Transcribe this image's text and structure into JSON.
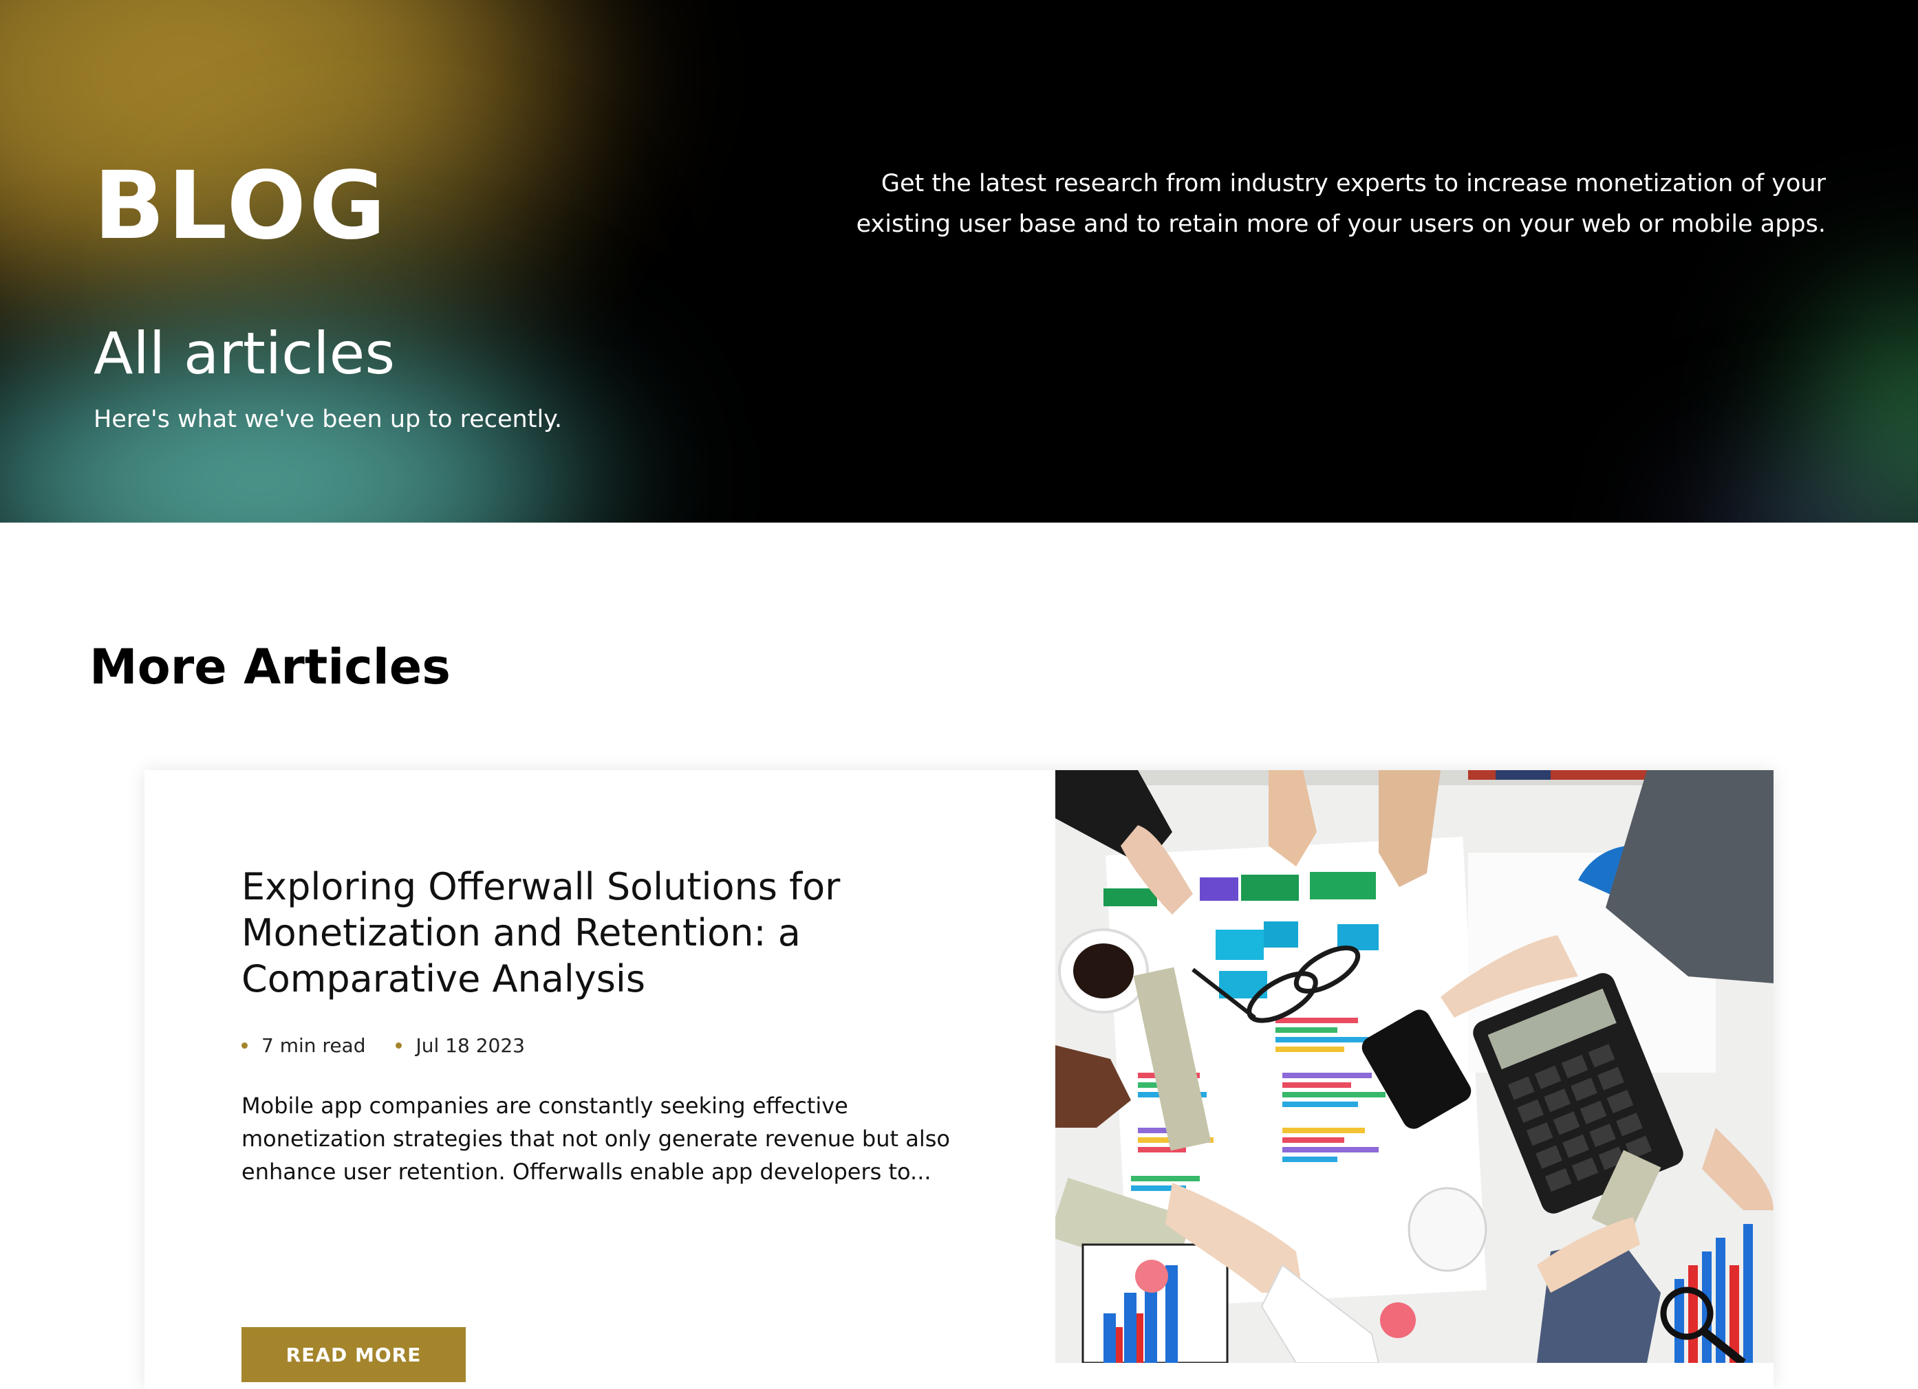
{
  "hero": {
    "title": "BLOG",
    "description": "Get the latest research from industry experts to increase monetization of your existing user base and to retain more of your users on your web or mobile apps.",
    "subtitle": "All articles",
    "tagline": "Here's what we've been up to recently."
  },
  "more_articles": {
    "heading": "More Articles",
    "articles": [
      {
        "title": "Exploring Offerwall Solutions for Monetization and Retention: a Comparative Analysis",
        "read_time": "7 min read",
        "date": "Jul 18 2023",
        "excerpt": "Mobile app companies are constantly seeking effective monetization strategies that not only generate revenue but also enhance user retention. Offerwalls enable app developers to...",
        "button_label": "READ MORE",
        "image_subject": "business-meeting-money-charts-photo"
      }
    ]
  },
  "colors": {
    "accent": "#a4852c",
    "hero_background": "#000000",
    "hero_gold": "#a6862c",
    "hero_teal": "#58a89d",
    "hero_green": "#2f7a45"
  }
}
